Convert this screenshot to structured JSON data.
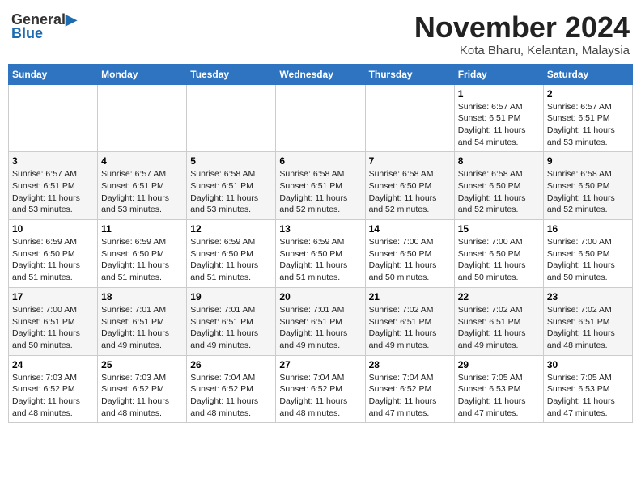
{
  "header": {
    "logo_general": "General",
    "logo_blue": "Blue",
    "month_title": "November 2024",
    "subtitle": "Kota Bharu, Kelantan, Malaysia"
  },
  "weekdays": [
    "Sunday",
    "Monday",
    "Tuesday",
    "Wednesday",
    "Thursday",
    "Friday",
    "Saturday"
  ],
  "weeks": [
    [
      {
        "day": "",
        "info": ""
      },
      {
        "day": "",
        "info": ""
      },
      {
        "day": "",
        "info": ""
      },
      {
        "day": "",
        "info": ""
      },
      {
        "day": "",
        "info": ""
      },
      {
        "day": "1",
        "info": "Sunrise: 6:57 AM\nSunset: 6:51 PM\nDaylight: 11 hours\nand 54 minutes."
      },
      {
        "day": "2",
        "info": "Sunrise: 6:57 AM\nSunset: 6:51 PM\nDaylight: 11 hours\nand 53 minutes."
      }
    ],
    [
      {
        "day": "3",
        "info": "Sunrise: 6:57 AM\nSunset: 6:51 PM\nDaylight: 11 hours\nand 53 minutes."
      },
      {
        "day": "4",
        "info": "Sunrise: 6:57 AM\nSunset: 6:51 PM\nDaylight: 11 hours\nand 53 minutes."
      },
      {
        "day": "5",
        "info": "Sunrise: 6:58 AM\nSunset: 6:51 PM\nDaylight: 11 hours\nand 53 minutes."
      },
      {
        "day": "6",
        "info": "Sunrise: 6:58 AM\nSunset: 6:51 PM\nDaylight: 11 hours\nand 52 minutes."
      },
      {
        "day": "7",
        "info": "Sunrise: 6:58 AM\nSunset: 6:50 PM\nDaylight: 11 hours\nand 52 minutes."
      },
      {
        "day": "8",
        "info": "Sunrise: 6:58 AM\nSunset: 6:50 PM\nDaylight: 11 hours\nand 52 minutes."
      },
      {
        "day": "9",
        "info": "Sunrise: 6:58 AM\nSunset: 6:50 PM\nDaylight: 11 hours\nand 52 minutes."
      }
    ],
    [
      {
        "day": "10",
        "info": "Sunrise: 6:59 AM\nSunset: 6:50 PM\nDaylight: 11 hours\nand 51 minutes."
      },
      {
        "day": "11",
        "info": "Sunrise: 6:59 AM\nSunset: 6:50 PM\nDaylight: 11 hours\nand 51 minutes."
      },
      {
        "day": "12",
        "info": "Sunrise: 6:59 AM\nSunset: 6:50 PM\nDaylight: 11 hours\nand 51 minutes."
      },
      {
        "day": "13",
        "info": "Sunrise: 6:59 AM\nSunset: 6:50 PM\nDaylight: 11 hours\nand 51 minutes."
      },
      {
        "day": "14",
        "info": "Sunrise: 7:00 AM\nSunset: 6:50 PM\nDaylight: 11 hours\nand 50 minutes."
      },
      {
        "day": "15",
        "info": "Sunrise: 7:00 AM\nSunset: 6:50 PM\nDaylight: 11 hours\nand 50 minutes."
      },
      {
        "day": "16",
        "info": "Sunrise: 7:00 AM\nSunset: 6:50 PM\nDaylight: 11 hours\nand 50 minutes."
      }
    ],
    [
      {
        "day": "17",
        "info": "Sunrise: 7:00 AM\nSunset: 6:51 PM\nDaylight: 11 hours\nand 50 minutes."
      },
      {
        "day": "18",
        "info": "Sunrise: 7:01 AM\nSunset: 6:51 PM\nDaylight: 11 hours\nand 49 minutes."
      },
      {
        "day": "19",
        "info": "Sunrise: 7:01 AM\nSunset: 6:51 PM\nDaylight: 11 hours\nand 49 minutes."
      },
      {
        "day": "20",
        "info": "Sunrise: 7:01 AM\nSunset: 6:51 PM\nDaylight: 11 hours\nand 49 minutes."
      },
      {
        "day": "21",
        "info": "Sunrise: 7:02 AM\nSunset: 6:51 PM\nDaylight: 11 hours\nand 49 minutes."
      },
      {
        "day": "22",
        "info": "Sunrise: 7:02 AM\nSunset: 6:51 PM\nDaylight: 11 hours\nand 49 minutes."
      },
      {
        "day": "23",
        "info": "Sunrise: 7:02 AM\nSunset: 6:51 PM\nDaylight: 11 hours\nand 48 minutes."
      }
    ],
    [
      {
        "day": "24",
        "info": "Sunrise: 7:03 AM\nSunset: 6:52 PM\nDaylight: 11 hours\nand 48 minutes."
      },
      {
        "day": "25",
        "info": "Sunrise: 7:03 AM\nSunset: 6:52 PM\nDaylight: 11 hours\nand 48 minutes."
      },
      {
        "day": "26",
        "info": "Sunrise: 7:04 AM\nSunset: 6:52 PM\nDaylight: 11 hours\nand 48 minutes."
      },
      {
        "day": "27",
        "info": "Sunrise: 7:04 AM\nSunset: 6:52 PM\nDaylight: 11 hours\nand 48 minutes."
      },
      {
        "day": "28",
        "info": "Sunrise: 7:04 AM\nSunset: 6:52 PM\nDaylight: 11 hours\nand 47 minutes."
      },
      {
        "day": "29",
        "info": "Sunrise: 7:05 AM\nSunset: 6:53 PM\nDaylight: 11 hours\nand 47 minutes."
      },
      {
        "day": "30",
        "info": "Sunrise: 7:05 AM\nSunset: 6:53 PM\nDaylight: 11 hours\nand 47 minutes."
      }
    ]
  ]
}
